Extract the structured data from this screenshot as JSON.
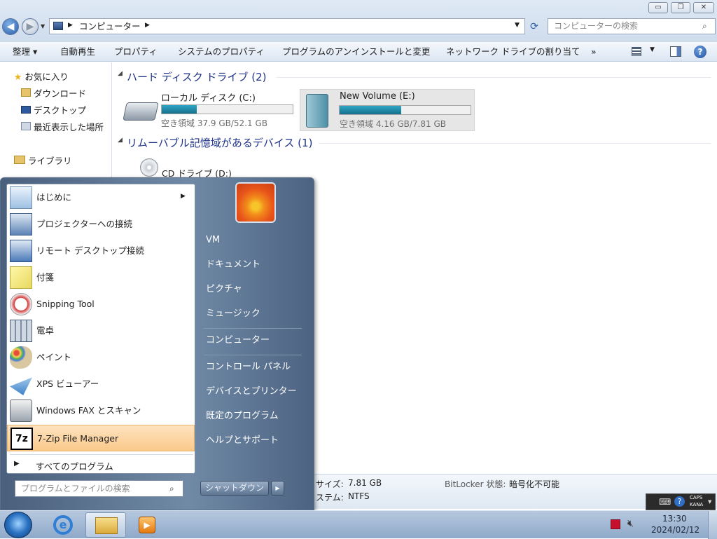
{
  "window": {
    "address_crumb": "コンピューター",
    "search_placeholder": "コンピューターの検索",
    "win_minimize": "▭",
    "win_restore": "❐",
    "win_close": "✕"
  },
  "toolbar": {
    "organize": "整理 ▾",
    "autoplay": "自動再生",
    "properties": "プロパティ",
    "system_properties": "システムのプロパティ",
    "uninstall": "プログラムのアンインストールと変更",
    "map_drive": "ネットワーク ドライブの割り当て",
    "more": "»"
  },
  "navpane": {
    "favorites": "お気に入り",
    "downloads": "ダウンロード",
    "desktop": "デスクトップ",
    "recent": "最近表示した場所",
    "libraries": "ライブラリ"
  },
  "main": {
    "hdd_group": "ハード ディスク ドライブ (2)",
    "drives": [
      {
        "name": "ローカル ディスク (C:)",
        "free": "空き領域 37.9 GB/52.1 GB",
        "used_fraction": 0.27
      },
      {
        "name": "New Volume (E:)",
        "free": "空き領域 4.16 GB/7.81 GB",
        "used_fraction": 0.47
      }
    ],
    "removable_group": "リムーバブル記憶域があるデバイス (1)",
    "cd_name": "CD ドライブ (D:)"
  },
  "details": {
    "size_label": "サイズ:",
    "size_value": "7.81 GB",
    "fs_label": "ステム:",
    "fs_value": "NTFS",
    "bitlocker_label": "BitLocker 状態:",
    "bitlocker_value": "暗号化不可能"
  },
  "startmenu": {
    "programs": [
      "はじめに",
      "プロジェクターへの接続",
      "リモート デスクトップ接続",
      "付箋",
      "Snipping Tool",
      "電卓",
      "ペイント",
      "XPS ビューアー",
      "Windows FAX とスキャン",
      "7-Zip File Manager"
    ],
    "all_programs": "すべてのプログラム",
    "search_placeholder": "プログラムとファイルの検索",
    "right_links": [
      "VM",
      "ドキュメント",
      "ピクチャ",
      "ミュージック",
      "コンピューター",
      "コントロール パネル",
      "デバイスとプリンター",
      "既定のプログラム",
      "ヘルプとサポート"
    ],
    "shutdown": "シャットダウン"
  },
  "tray": {
    "caps": "CAPS",
    "kana": "KANA",
    "time": "13:30",
    "date": "2024/02/12"
  }
}
